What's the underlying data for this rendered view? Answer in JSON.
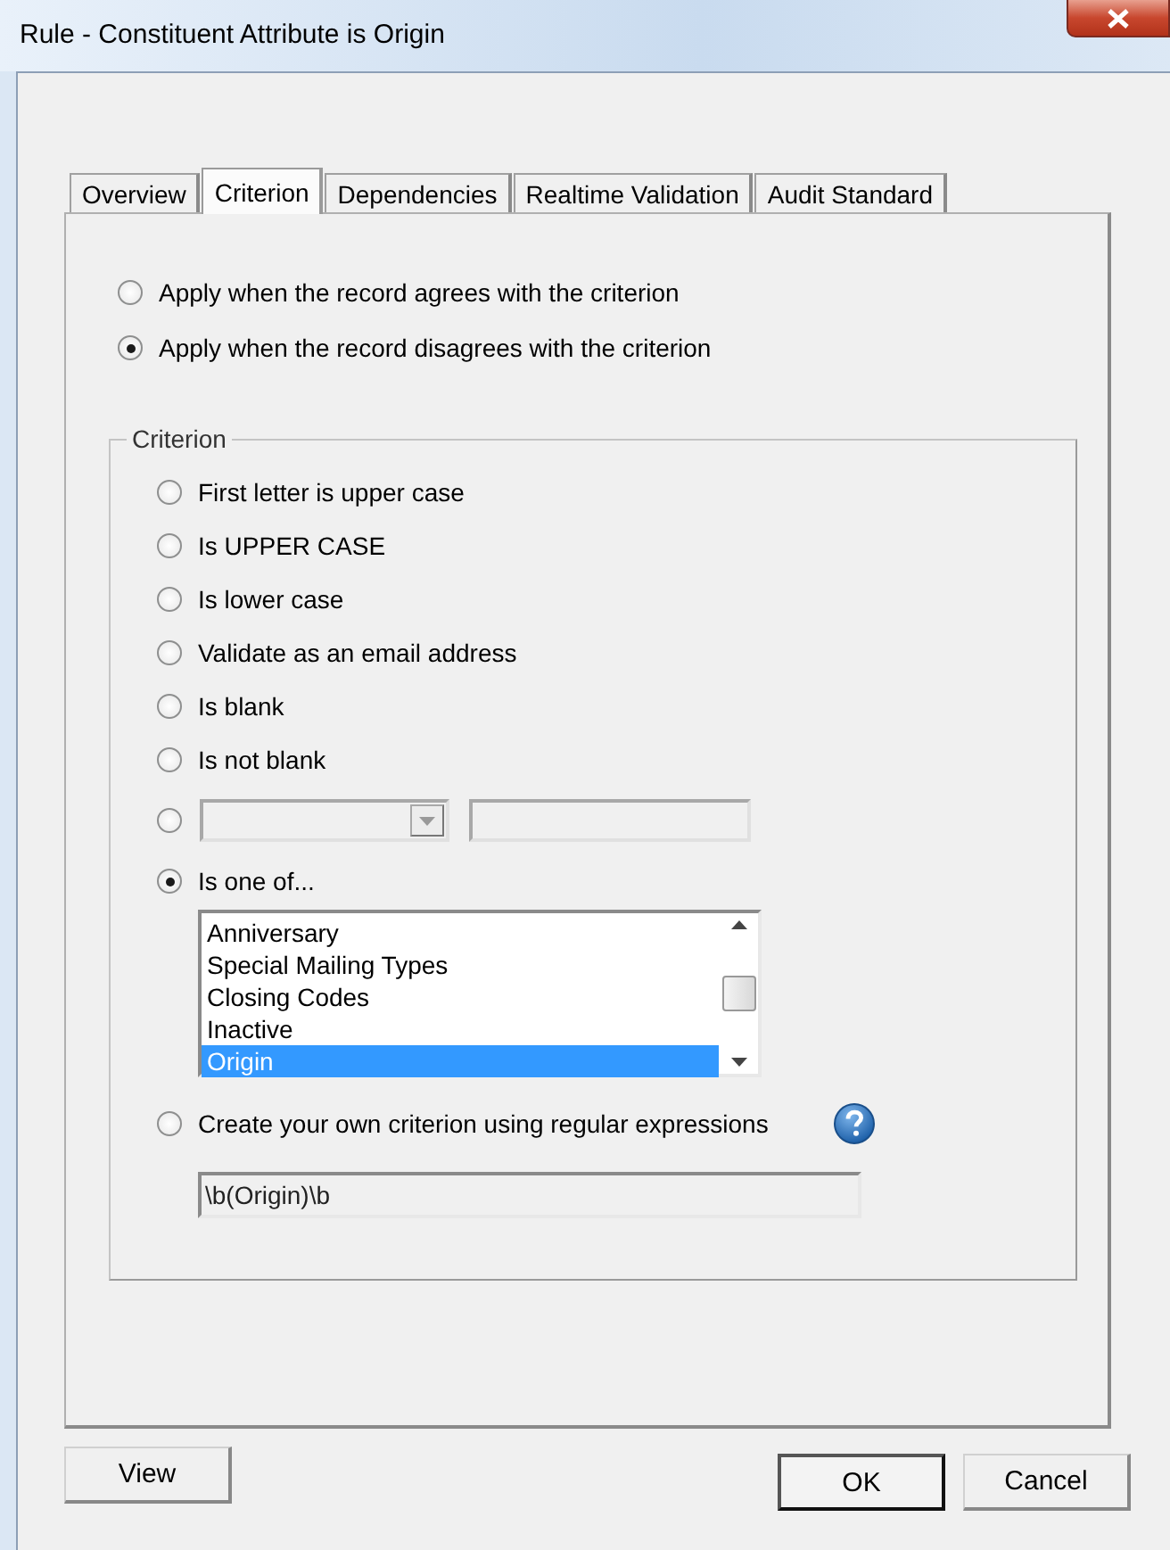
{
  "window": {
    "title": "Rule - Constituent Attribute is Origin"
  },
  "tabs": [
    {
      "label": "Overview",
      "selected": false
    },
    {
      "label": "Criterion",
      "selected": true
    },
    {
      "label": "Dependencies",
      "selected": false
    },
    {
      "label": "Realtime Validation",
      "selected": false
    },
    {
      "label": "Audit Standard",
      "selected": false
    }
  ],
  "apply_options": [
    {
      "label": "Apply when the record agrees with the criterion",
      "selected": false
    },
    {
      "label": "Apply when the record disagrees with the criterion",
      "selected": true
    }
  ],
  "criterion": {
    "title": "Criterion",
    "options": [
      {
        "kind": "plain",
        "label": "First letter is upper case",
        "selected": false
      },
      {
        "kind": "plain",
        "label": "Is UPPER CASE",
        "selected": false
      },
      {
        "kind": "plain",
        "label": "Is lower case",
        "selected": false
      },
      {
        "kind": "plain",
        "label": "Validate as an email address",
        "selected": false
      },
      {
        "kind": "plain",
        "label": "Is blank",
        "selected": false
      },
      {
        "kind": "plain",
        "label": "Is not blank",
        "selected": false
      },
      {
        "kind": "compare",
        "selected": false
      },
      {
        "kind": "list",
        "label": "Is one of...",
        "selected": true,
        "items": [
          {
            "label": "Anniversary",
            "selected": false
          },
          {
            "label": "Special Mailing Types",
            "selected": false
          },
          {
            "label": "Closing Codes",
            "selected": false
          },
          {
            "label": "Inactive",
            "selected": false
          },
          {
            "label": "Origin",
            "selected": true
          }
        ]
      },
      {
        "kind": "regex",
        "label": "Create your own criterion using regular expressions",
        "selected": false,
        "value": "\\b(Origin)\\b"
      }
    ]
  },
  "buttons": [
    {
      "label": "View",
      "default": false
    },
    {
      "label": "OK",
      "default": true
    },
    {
      "label": "Cancel",
      "default": false
    }
  ]
}
